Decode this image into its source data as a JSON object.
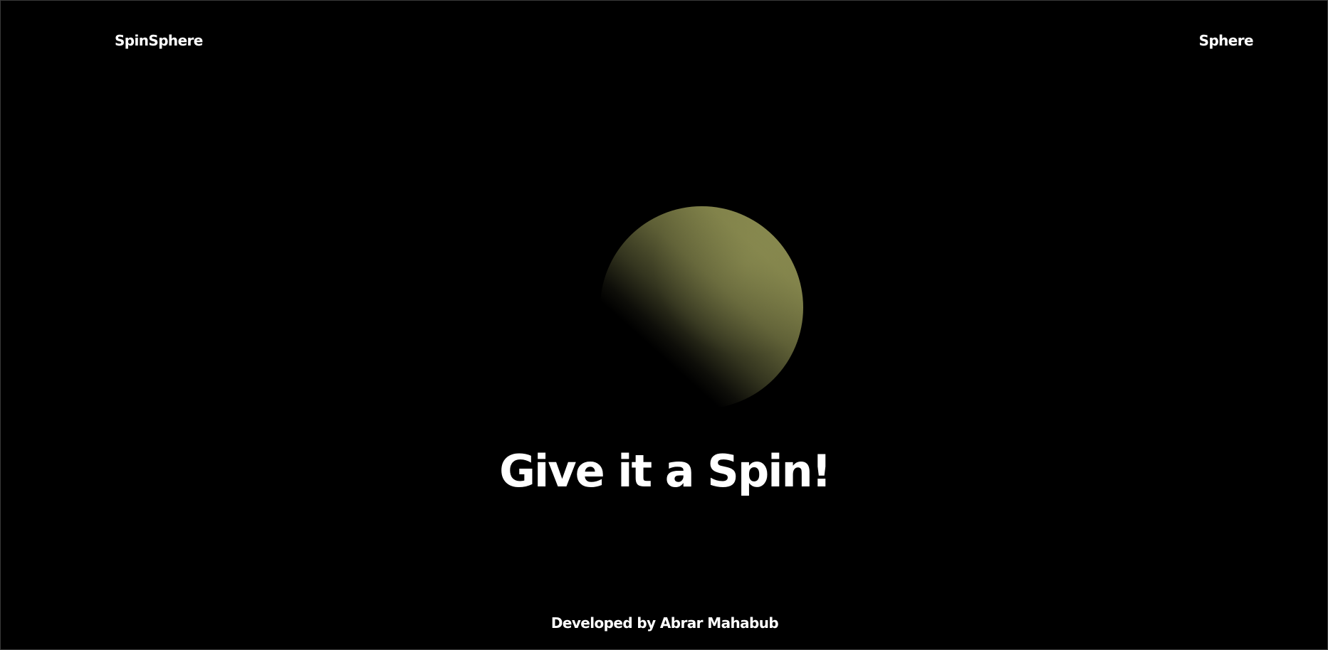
{
  "header": {
    "brand": "SpinSphere",
    "nav_link": "Sphere"
  },
  "hero": {
    "headline": "Give it a Spin!"
  },
  "footer": {
    "credit": "Developed by Abrar Mahabub"
  },
  "colors": {
    "background": "#000000",
    "text": "#ffffff",
    "sphere_light": "#8a8b4f",
    "sphere_dark": "#000000"
  }
}
